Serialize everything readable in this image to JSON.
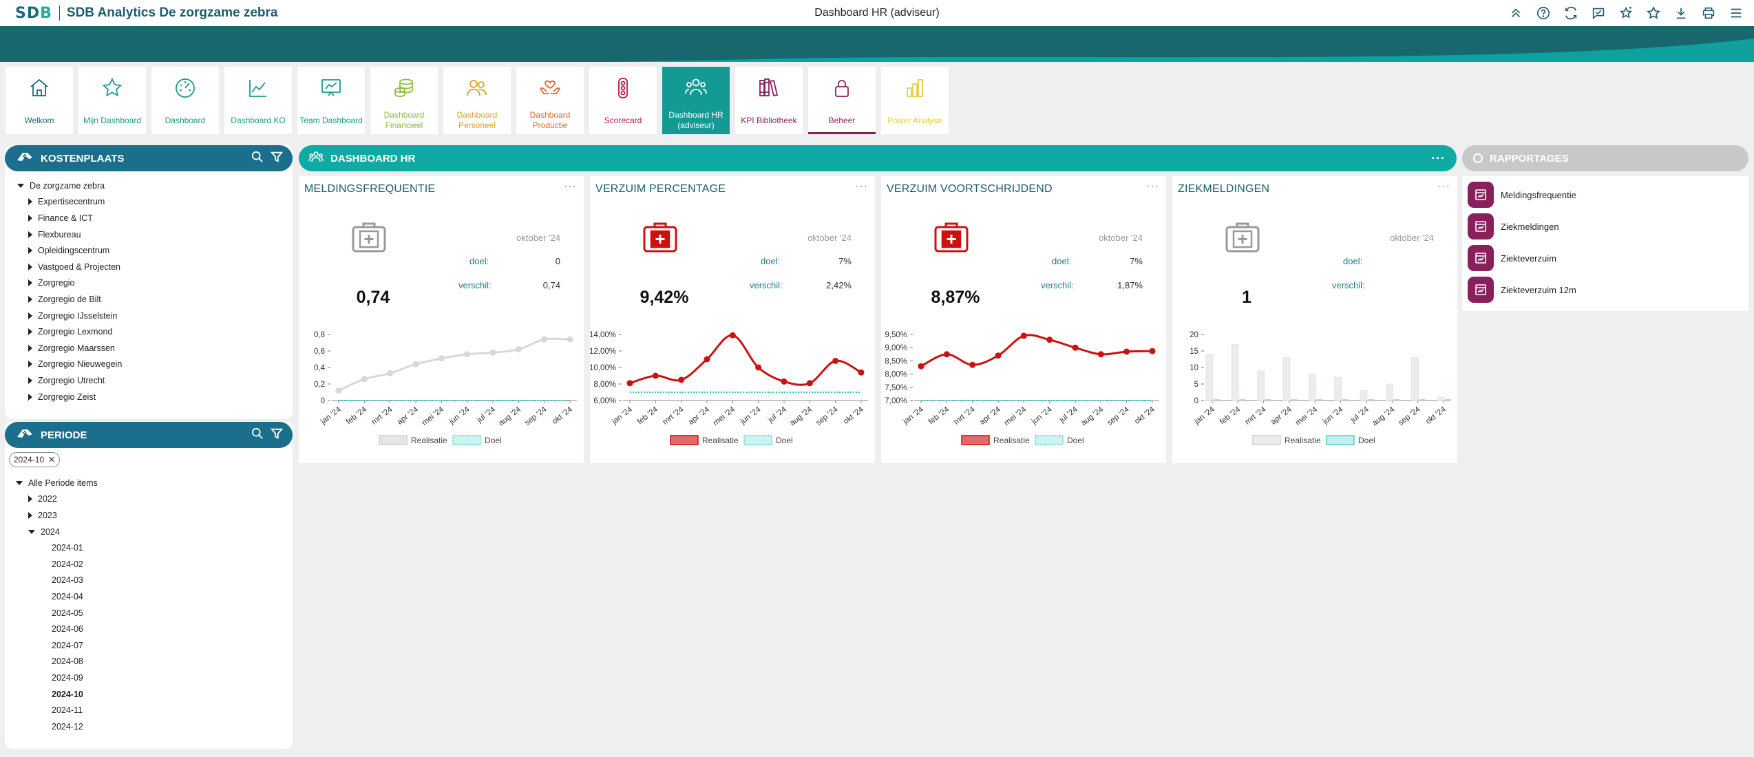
{
  "header": {
    "logo": "SDB",
    "app_title": "SDB Analytics De zorgzame zebra",
    "page_title": "Dashboard HR (adviseur)",
    "icons": [
      "collapse-up-icon",
      "help-icon",
      "refresh-icon",
      "comment-icon",
      "sparkle-star-icon",
      "star-icon",
      "download-icon",
      "print-icon",
      "menu-icon"
    ]
  },
  "nav": [
    {
      "label": "Welkom",
      "icon": "home-icon",
      "color": "#1a6b78"
    },
    {
      "label": "Mijn Dashboard",
      "icon": "star-icon",
      "color": "#1a9a8a"
    },
    {
      "label": "Dashboard",
      "icon": "gauge-icon",
      "color": "#1a9a8a"
    },
    {
      "label": "Dashboard KO",
      "icon": "line-chart-icon",
      "color": "#1a9a8a"
    },
    {
      "label": "Team Dashboard",
      "icon": "presentation-icon",
      "color": "#1a9a8a"
    },
    {
      "label": "Dashboard Financieel",
      "icon": "coins-icon",
      "color": "#8cbf3f"
    },
    {
      "label": "Dashboard Personeel",
      "icon": "people-icon",
      "color": "#e0a21a"
    },
    {
      "label": "Dashboard Productie",
      "icon": "care-hands-icon",
      "color": "#e06a2c"
    },
    {
      "label": "Scorecard",
      "icon": "traffic-light-icon",
      "color": "#b0164a"
    },
    {
      "label": "Dashboard HR (adviseur)",
      "icon": "team-icon",
      "color": "#ffffff",
      "active": true
    },
    {
      "label": "KPI Bibliotheek",
      "icon": "books-icon",
      "color": "#8a1f5d"
    },
    {
      "label": "Beheer",
      "icon": "lock-icon",
      "color": "#8a1f5d",
      "underline": true
    },
    {
      "label": "Power Analyse",
      "icon": "bar-chart-icon",
      "color": "#e6cc47"
    }
  ],
  "kostenplaats": {
    "title": "KOSTENPLAATS",
    "root": "De zorgzame zebra",
    "items": [
      "Expertisecentrum",
      "Finance & ICT",
      "Flexbureau",
      "Opleidingscentrum",
      "Vastgoed & Projecten",
      "Zorgregio",
      "Zorgregio de Bilt",
      "Zorgregio IJsselstein",
      "Zorgregio Lexmond",
      "Zorgregio Maarssen",
      "Zorgregio Nieuwegein",
      "Zorgregio Utrecht",
      "Zorgregio Zeist"
    ]
  },
  "periode": {
    "title": "PERIODE",
    "chip": "2024-10",
    "root": "Alle Periode items",
    "years": [
      "2022",
      "2023",
      "2024"
    ],
    "months": [
      "2024-01",
      "2024-02",
      "2024-03",
      "2024-04",
      "2024-05",
      "2024-06",
      "2024-07",
      "2024-08",
      "2024-09",
      "2024-10",
      "2024-11",
      "2024-12"
    ],
    "selected": "2024-10"
  },
  "dashboard": {
    "title": "DASHBOARD HR",
    "dots": "···",
    "label_doel": "doel:",
    "label_verschil": "verschil:",
    "legend_real": "Realisatie",
    "legend_doel": "Doel"
  },
  "cards": [
    {
      "title": "MELDINGSFREQUENTIE",
      "period": "oktober '24",
      "doel": "0",
      "verschil": "0,74",
      "value": "0,74",
      "icon_color": "#999999"
    },
    {
      "title": "VERZUIM PERCENTAGE",
      "period": "oktober '24",
      "doel": "7%",
      "verschil": "2,42%",
      "value": "9,42%",
      "icon_color": "#cc1111"
    },
    {
      "title": "VERZUIM VOORTSCHRIJDEND",
      "period": "oktober '24",
      "doel": "7%",
      "verschil": "1,87%",
      "value": "8,87%",
      "icon_color": "#cc1111"
    },
    {
      "title": "ZIEKMELDINGEN",
      "period": "oktober '24",
      "doel": "",
      "verschil": "",
      "value": "1",
      "icon_color": "#999999"
    }
  ],
  "chart_data": [
    {
      "type": "line",
      "x": [
        "jan '24",
        "feb '24",
        "mrt '24",
        "apr '24",
        "mei '24",
        "jun '24",
        "jul '24",
        "aug '24",
        "sep '24",
        "okt '24"
      ],
      "ytick_labels": [
        "0",
        "0,2",
        "0,4",
        "0,6",
        "0,8"
      ],
      "ylim": [
        0,
        0.8
      ],
      "series": [
        {
          "name": "Realisatie",
          "values": [
            0.12,
            0.26,
            0.33,
            0.44,
            0.51,
            0.56,
            0.58,
            0.62,
            0.74,
            0.74
          ],
          "color": "#d8d8d8"
        },
        {
          "name": "Doel",
          "values": [
            0,
            0,
            0,
            0,
            0,
            0,
            0,
            0,
            0,
            0
          ],
          "color": "#2ec4c4"
        }
      ]
    },
    {
      "type": "line",
      "x": [
        "jan '24",
        "feb '24",
        "mrt '24",
        "apr '24",
        "mei '24",
        "jun '24",
        "jul '24",
        "aug '24",
        "sep '24",
        "okt '24"
      ],
      "ytick_labels": [
        "6,00%",
        "8,00%",
        "10,00%",
        "12,00%",
        "14,00%"
      ],
      "ylim": [
        6,
        14
      ],
      "series": [
        {
          "name": "Realisatie",
          "values": [
            8.1,
            9.0,
            8.5,
            11.0,
            13.9,
            10.0,
            8.3,
            8.1,
            10.8,
            9.4
          ],
          "color": "#cc1111"
        },
        {
          "name": "Doel",
          "values": [
            7,
            7,
            7,
            7,
            7,
            7,
            7,
            7,
            7,
            7
          ],
          "color": "#2ec4c4"
        }
      ]
    },
    {
      "type": "line",
      "x": [
        "jan '24",
        "feb '24",
        "mrt '24",
        "apr '24",
        "mei '24",
        "jun '24",
        "jul '24",
        "aug '24",
        "sep '24",
        "okt '24"
      ],
      "ytick_labels": [
        "7,00%",
        "7,50%",
        "8,00%",
        "8,50%",
        "9,00%",
        "9,50%"
      ],
      "ylim": [
        7,
        9.5
      ],
      "series": [
        {
          "name": "Realisatie",
          "values": [
            8.3,
            8.75,
            8.35,
            8.7,
            9.45,
            9.3,
            9.0,
            8.75,
            8.85,
            8.87
          ],
          "color": "#cc1111"
        },
        {
          "name": "Doel",
          "values": [
            7,
            7,
            7,
            7,
            7,
            7,
            7,
            7,
            7,
            7
          ],
          "color": "#2ec4c4"
        }
      ]
    },
    {
      "type": "bar",
      "x": [
        "jan '24",
        "feb '24",
        "mrt '24",
        "apr '24",
        "mei '24",
        "jun '24",
        "jul '24",
        "aug '24",
        "sep '24",
        "okt '24"
      ],
      "ytick_labels": [
        "0",
        "5",
        "10",
        "15",
        "20"
      ],
      "ylim": [
        0,
        20
      ],
      "series": [
        {
          "name": "Realisatie",
          "values": [
            14,
            17,
            9,
            13,
            8,
            7,
            3,
            5,
            13,
            1
          ],
          "color": "#ececec"
        },
        {
          "name": "Doel",
          "values": [
            0,
            0,
            0,
            0,
            0,
            0,
            0,
            0,
            0,
            0
          ],
          "color": "#9fe8e4"
        }
      ]
    }
  ],
  "rapportages": {
    "title": "RAPPORTAGES",
    "items": [
      "Meldingsfrequentie",
      "Ziekmeldingen",
      "Ziekteverzuim",
      "Ziekteverzuim 12m"
    ]
  }
}
